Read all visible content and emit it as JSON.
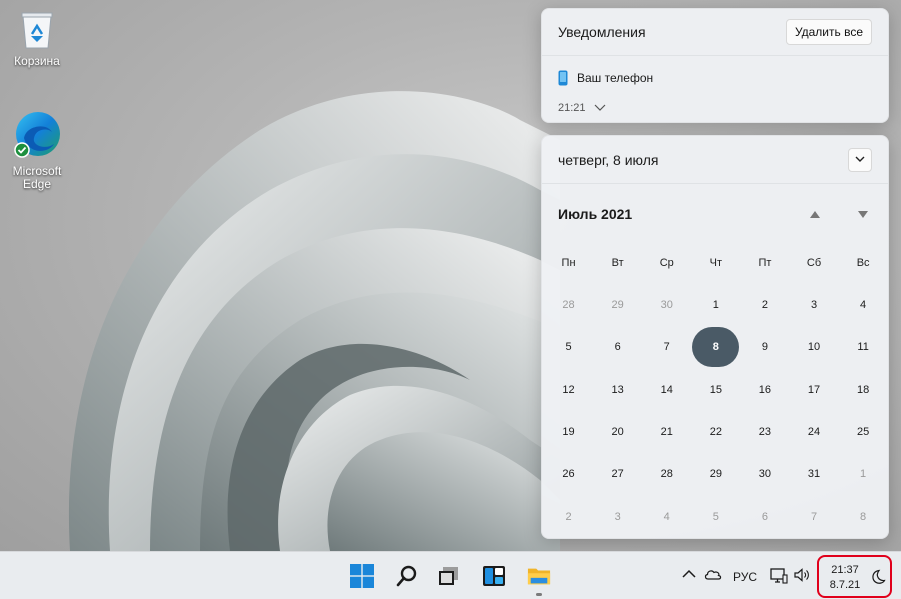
{
  "desktop": {
    "icons": [
      {
        "label": "Корзина",
        "icon": "recycle-bin-icon"
      },
      {
        "label": "Microsoft Edge",
        "icon": "edge-icon"
      }
    ]
  },
  "notifications": {
    "title": "Уведомления",
    "clear_all_label": "Удалить все",
    "items": [
      {
        "app": "Ваш телефон",
        "time": "21:21",
        "icon": "phone-icon"
      }
    ]
  },
  "calendar": {
    "date_label": "четверг, 8 июля",
    "month_label": "Июль 2021",
    "weekdays": [
      "Пн",
      "Вт",
      "Ср",
      "Чт",
      "Пт",
      "Сб",
      "Вс"
    ],
    "today": 8,
    "days": [
      {
        "d": "28",
        "muted": true
      },
      {
        "d": "29",
        "muted": true
      },
      {
        "d": "30",
        "muted": true
      },
      {
        "d": "1"
      },
      {
        "d": "2"
      },
      {
        "d": "3"
      },
      {
        "d": "4"
      },
      {
        "d": "5"
      },
      {
        "d": "6"
      },
      {
        "d": "7"
      },
      {
        "d": "8",
        "today": true
      },
      {
        "d": "9"
      },
      {
        "d": "10"
      },
      {
        "d": "11"
      },
      {
        "d": "12"
      },
      {
        "d": "13"
      },
      {
        "d": "14"
      },
      {
        "d": "15"
      },
      {
        "d": "16"
      },
      {
        "d": "17"
      },
      {
        "d": "18"
      },
      {
        "d": "19"
      },
      {
        "d": "20"
      },
      {
        "d": "21"
      },
      {
        "d": "22"
      },
      {
        "d": "23"
      },
      {
        "d": "24"
      },
      {
        "d": "25"
      },
      {
        "d": "26"
      },
      {
        "d": "27"
      },
      {
        "d": "28"
      },
      {
        "d": "29"
      },
      {
        "d": "30"
      },
      {
        "d": "31"
      },
      {
        "d": "1",
        "muted": true
      },
      {
        "d": "2",
        "muted": true
      },
      {
        "d": "3",
        "muted": true
      },
      {
        "d": "4",
        "muted": true
      },
      {
        "d": "5",
        "muted": true
      },
      {
        "d": "6",
        "muted": true
      },
      {
        "d": "7",
        "muted": true
      },
      {
        "d": "8",
        "muted": true
      }
    ]
  },
  "taskbar": {
    "pinned": [
      "start-icon",
      "search-icon",
      "task-view-icon",
      "widgets-icon",
      "file-explorer-icon"
    ],
    "language": "РУС",
    "time": "21:37",
    "date": "8.7.21",
    "highlight_color": "#e0001b"
  }
}
